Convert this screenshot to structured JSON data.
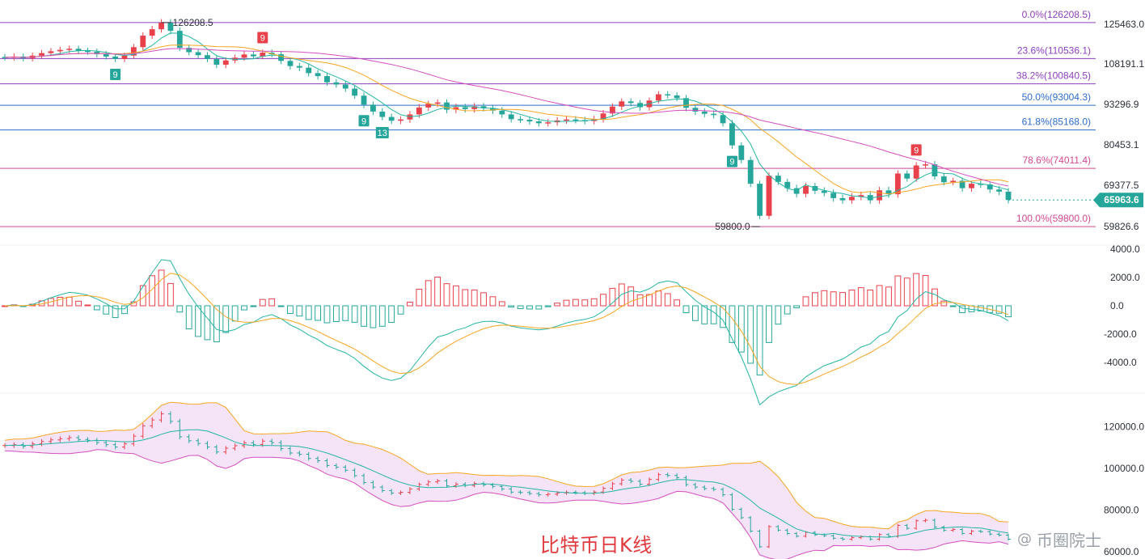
{
  "caption": "比特币日K线",
  "watermark": {
    "at": "@",
    "text": "币圈院士"
  },
  "colors": {
    "up": "#e8414b",
    "down": "#26a69a",
    "ma_fast": "#26b5a3",
    "ma_mid": "#f5a623",
    "ma_slow": "#d34fc0",
    "price_tag": "#26a69a",
    "boll_fill": "#f1d9f5"
  },
  "chart_data": [
    {
      "type": "candlestick",
      "panel": "price",
      "y_ticks": [
        "125463.0",
        "108191.1",
        "93296.9",
        "80453.1",
        "69377.5",
        "59826.6"
      ],
      "y_tick_values": [
        125463.0,
        108191.1,
        93296.9,
        80453.1,
        69377.5,
        59826.6
      ],
      "current_price": "65963.6",
      "current_value": 65963.6,
      "high_marker": {
        "label": "126208.5",
        "value": 126208.5
      },
      "low_marker": {
        "label": "59800.0",
        "value": 59800.0
      },
      "fibonacci": [
        {
          "label": "0.0%(126208.5)",
          "value": 126208.5,
          "color": "#8e3fbf"
        },
        {
          "label": "23.6%(110536.1)",
          "value": 110536.1,
          "color": "#8e3fbf"
        },
        {
          "label": "38.2%(100840.5)",
          "value": 100840.5,
          "color": "#8e3fbf"
        },
        {
          "label": "50.0%(93004.3)",
          "value": 93004.3,
          "color": "#2f6ecb"
        },
        {
          "label": "61.8%(85168.0)",
          "value": 85168.0,
          "color": "#2f6ecb"
        },
        {
          "label": "78.6%(74011.4)",
          "value": 74011.4,
          "color": "#d1488f"
        },
        {
          "label": "100.0%(59800.0)",
          "value": 59800.0,
          "color": "#d1488f"
        }
      ],
      "td_markers": [
        {
          "label": "9",
          "side": "below",
          "index": 12
        },
        {
          "label": "9",
          "side": "above",
          "index": 28
        },
        {
          "label": "9",
          "side": "below",
          "index": 39
        },
        {
          "label": "13",
          "side": "below",
          "index": 41
        },
        {
          "label": "9",
          "side": "below",
          "index": 79
        },
        {
          "label": "9",
          "side": "above",
          "index": 99
        }
      ],
      "close": [
        111000,
        111400,
        110600,
        111800,
        112900,
        113700,
        114300,
        114800,
        113900,
        113500,
        112400,
        111400,
        110300,
        111800,
        115500,
        120500,
        123300,
        126208,
        122600,
        115200,
        113300,
        112000,
        110300,
        107900,
        109700,
        110900,
        112300,
        111500,
        113100,
        112400,
        109500,
        107400,
        106800,
        104800,
        103700,
        101400,
        100600,
        99100,
        96500,
        93200,
        91000,
        89300,
        88100,
        88500,
        90100,
        92300,
        93500,
        94000,
        91600,
        92400,
        91800,
        92700,
        92100,
        91300,
        90100,
        88600,
        88400,
        87900,
        87300,
        87600,
        88200,
        88500,
        88300,
        88000,
        88600,
        90400,
        92600,
        94400,
        93800,
        92400,
        94700,
        97000,
        96600,
        95600,
        92200,
        91000,
        90300,
        89900,
        87300,
        80300,
        76300,
        69800,
        62300,
        72000,
        70300,
        68700,
        67400,
        69200,
        68100,
        67600,
        66400,
        65900,
        66700,
        67100,
        65900,
        68200,
        67300,
        72600,
        71200,
        74800,
        75100,
        71800,
        70200,
        70600,
        68700,
        69800,
        69600,
        68400,
        67900,
        65963.6
      ],
      "macd_ticks": [
        "4000.0",
        "2000.0",
        "0.0",
        "-2000.0",
        "-4000.0"
      ],
      "macd_tick_values": [
        4000,
        2000,
        0,
        -2000,
        -4000
      ],
      "boll_ticks": [
        "120000.0",
        "100000.0",
        "80000.0",
        "60000.0"
      ],
      "boll_tick_values": [
        120000,
        100000,
        80000,
        60000
      ]
    }
  ]
}
